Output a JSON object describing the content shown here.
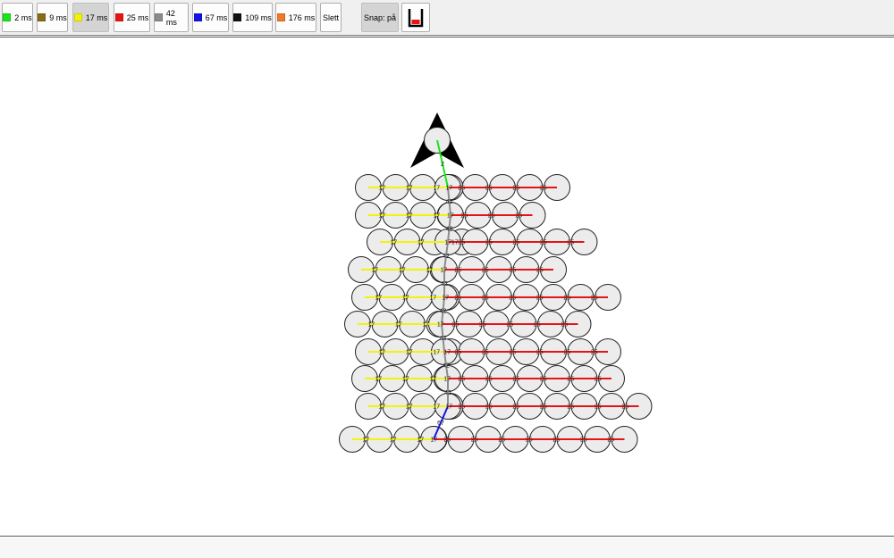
{
  "toolbar": {
    "buttons": [
      {
        "label": "2 ms",
        "color": "#19e619",
        "active": false
      },
      {
        "label": "9 ms",
        "color": "#8b6a14",
        "active": false
      },
      {
        "label": "17 ms",
        "color": "#f2f20a",
        "active": true
      },
      {
        "label": "25 ms",
        "color": "#e61414",
        "active": false
      },
      {
        "label": "42 ms",
        "color": "#8c8c8c",
        "active": false
      },
      {
        "label": "67 ms",
        "color": "#1414e6",
        "active": false
      },
      {
        "label": "109 ms",
        "color": "#111111",
        "active": false
      },
      {
        "label": "176 ms",
        "color": "#f07828",
        "active": false
      }
    ],
    "delete_label": "Slett",
    "snap_label": "Snap: på",
    "bucket_icon": "bucket-icon"
  },
  "diagram": {
    "arrow_icon": "north-arrow-icon",
    "main_line_labels": [
      "2",
      "42",
      "42",
      "42",
      "42",
      "42",
      "42",
      "42",
      "42",
      "67"
    ],
    "rows": [
      {
        "left_label": "17",
        "left_count": 4,
        "right_label": "25",
        "right_count": 4
      },
      {
        "left_label": "17",
        "left_count": 4,
        "right_label": "25",
        "right_count": 3
      },
      {
        "left_label": "17",
        "left_count": 4,
        "right_label": "25",
        "right_count": 5
      },
      {
        "left_label": "17",
        "left_count": 4,
        "right_label": "25",
        "right_count": 4
      },
      {
        "left_label": "17",
        "left_count": 4,
        "right_label": "25",
        "right_count": 6
      },
      {
        "left_label": "17",
        "left_count": 4,
        "right_label": "25",
        "right_count": 5
      },
      {
        "left_label": "17",
        "left_count": 4,
        "right_label": "25",
        "right_count": 6
      },
      {
        "left_label": "17",
        "left_count": 4,
        "right_label": "25",
        "right_count": 6
      },
      {
        "left_label": "17",
        "left_count": 4,
        "right_label": "25",
        "right_count": 7
      },
      {
        "left_label": "17",
        "left_count": 4,
        "right_label": "25",
        "right_count": 7
      }
    ]
  }
}
